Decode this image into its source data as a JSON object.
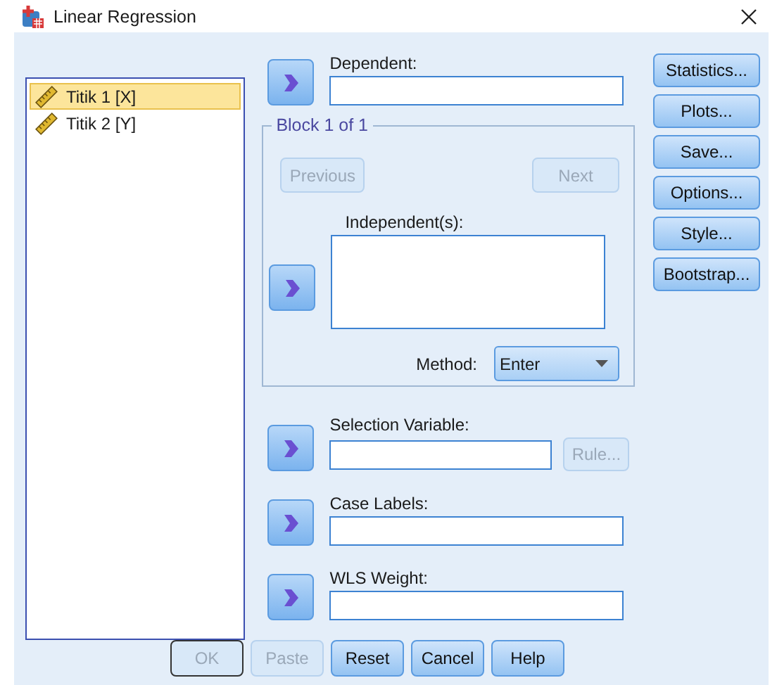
{
  "window": {
    "title": "Linear Regression"
  },
  "variables": [
    {
      "label": "Titik 1 [X]",
      "selected": true
    },
    {
      "label": "Titik 2 [Y]",
      "selected": false
    }
  ],
  "dependent": {
    "label": "Dependent:"
  },
  "block": {
    "legend": "Block 1 of 1",
    "nav": [
      {
        "label": "Previous",
        "disabled": true
      },
      {
        "label": "Next",
        "disabled": true
      }
    ],
    "independent": {
      "label": "Independent(s):"
    },
    "method": {
      "label": "Method:",
      "value": "Enter"
    }
  },
  "selection": {
    "label": "Selection Variable:",
    "rule": {
      "label": "Rule...",
      "disabled": true
    }
  },
  "case_labels": {
    "label": "Case Labels:"
  },
  "wls": {
    "label": "WLS Weight:"
  },
  "side_buttons": [
    {
      "label": "Statistics...",
      "disabled": false
    },
    {
      "label": "Plots...",
      "disabled": false
    },
    {
      "label": "Save...",
      "disabled": false
    },
    {
      "label": "Options...",
      "disabled": false
    },
    {
      "label": "Style...",
      "disabled": false
    },
    {
      "label": "Bootstrap...",
      "disabled": false
    }
  ],
  "bottom_buttons": [
    {
      "label": "OK",
      "disabled": true,
      "default": true
    },
    {
      "label": "Paste",
      "disabled": true,
      "default": false
    },
    {
      "label": "Reset",
      "disabled": false,
      "default": false
    },
    {
      "label": "Cancel",
      "disabled": false,
      "default": false
    },
    {
      "label": "Help",
      "disabled": false,
      "default": false
    }
  ]
}
